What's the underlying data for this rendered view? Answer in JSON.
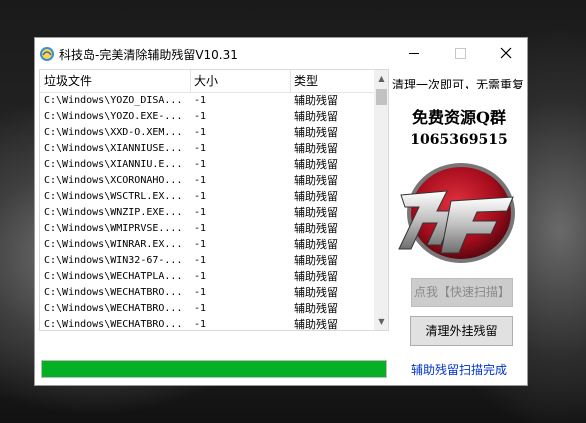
{
  "window": {
    "title": "科技岛-完美清除辅助残留V10.31",
    "controls": {
      "minimize_icon": "minimize-icon",
      "maximize_icon": "maximize-icon",
      "close_icon": "close-icon"
    }
  },
  "table": {
    "columns": [
      "垃圾文件",
      "大小",
      "类型"
    ],
    "rows": [
      {
        "path": "C:\\Windows\\YOZO_DISA...",
        "size": "-1",
        "type": "辅助残留"
      },
      {
        "path": "C:\\Windows\\YOZO.EXE-...",
        "size": "-1",
        "type": "辅助残留"
      },
      {
        "path": "C:\\Windows\\XXD-O.XEM...",
        "size": "-1",
        "type": "辅助残留"
      },
      {
        "path": "C:\\Windows\\XIANNIUSE...",
        "size": "-1",
        "type": "辅助残留"
      },
      {
        "path": "C:\\Windows\\XIANNIU.E...",
        "size": "-1",
        "type": "辅助残留"
      },
      {
        "path": "C:\\Windows\\XCORONAHO...",
        "size": "-1",
        "type": "辅助残留"
      },
      {
        "path": "C:\\Windows\\WSCTRL.EX...",
        "size": "-1",
        "type": "辅助残留"
      },
      {
        "path": "C:\\Windows\\WNZIP.EXE...",
        "size": "-1",
        "type": "辅助残留"
      },
      {
        "path": "C:\\Windows\\WMIPRVSE....",
        "size": "-1",
        "type": "辅助残留"
      },
      {
        "path": "C:\\Windows\\WINRAR.EX...",
        "size": "-1",
        "type": "辅助残留"
      },
      {
        "path": "C:\\Windows\\WIN32-67-...",
        "size": "-1",
        "type": "辅助残留"
      },
      {
        "path": "C:\\Windows\\WECHATPLA...",
        "size": "-1",
        "type": "辅助残留"
      },
      {
        "path": "C:\\Windows\\WECHATBRO...",
        "size": "-1",
        "type": "辅助残留"
      },
      {
        "path": "C:\\Windows\\WECHATBRO...",
        "size": "-1",
        "type": "辅助残留"
      },
      {
        "path": "C:\\Windows\\WECHATBRO...",
        "size": "-1",
        "type": "辅助残留"
      }
    ]
  },
  "progress": {
    "value_percent": 100,
    "color": "#06b025"
  },
  "side": {
    "banner": "清理一次即可，无需重复",
    "qq_group": "免费资源Q群",
    "qq_number": "1065369515",
    "scan_button": "点我【快速扫描】",
    "clean_button": "清理外挂残留",
    "status": "辅助残留扫描完成"
  },
  "colors": {
    "accent": "#06b025",
    "status_link": "#0033cc",
    "logo_red": "#c8102e"
  }
}
